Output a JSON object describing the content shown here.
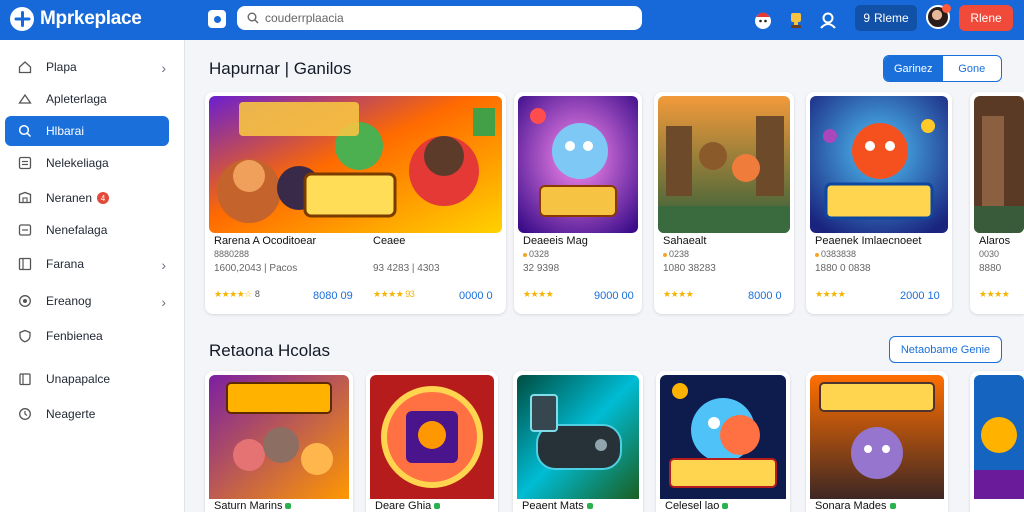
{
  "app": {
    "name": "Mprkeplace"
  },
  "search": {
    "placeholder": "couderrplaacia"
  },
  "header": {
    "pill_dark_label": "Rleme",
    "pill_dark_prefix": "9",
    "pill_red_label": "Rlene"
  },
  "sidebar": {
    "items": [
      {
        "label": "Plapa",
        "icon": "home-icon",
        "chevron": true
      },
      {
        "label": "Apleterlaga",
        "icon": "cloud-icon",
        "chevron": false
      },
      {
        "label": "Hlbarai",
        "icon": "search-icon",
        "chevron": false,
        "active": true
      },
      {
        "label": "Nelekeliaga",
        "icon": "grid-icon",
        "chevron": false
      },
      {
        "label": "Neranen",
        "icon": "chat-icon",
        "chevron": false,
        "badge": "4"
      },
      {
        "label": "Nenefalaga",
        "icon": "doc-icon",
        "chevron": false
      },
      {
        "label": "Farana",
        "icon": "calendar-icon",
        "chevron": true
      },
      {
        "label": "Ereanog",
        "icon": "gear-icon",
        "chevron": true
      },
      {
        "label": "Fenbienea",
        "icon": "shield-icon",
        "chevron": false
      },
      {
        "label": "Unapapalce",
        "icon": "box-icon",
        "chevron": false
      },
      {
        "label": "Neagerte",
        "icon": "clock-icon",
        "chevron": false
      }
    ]
  },
  "section1": {
    "title": "Hapurnar | Ganilos",
    "toggle": {
      "active": "Garinez",
      "inactive": "Gone"
    },
    "cards": [
      {
        "title": "Rarena A Ocoditoear",
        "title2": "Ceaee",
        "sub": "8880288",
        "meta": "1600,2043 | Pacos",
        "meta2": "93 4283 | 4303",
        "stars": "★★★★☆",
        "rating": "8",
        "rating2": "★★★★ 93",
        "price": "8080 09",
        "price2": "0000 0"
      },
      {
        "title": "Deaeeis Mag",
        "sub": "0328",
        "meta": "32 9398",
        "stars": "★★★★",
        "rating": "",
        "price": "9000 00"
      },
      {
        "title": "Sahaealt",
        "sub": "0238",
        "meta": "1080 38283",
        "stars": "★★★★",
        "rating": "",
        "price": "8000 0"
      },
      {
        "title": "Peaenek Imlaecnoeet",
        "sub": "0383838",
        "meta": "1880 0 0838",
        "stars": "★★★★",
        "rating": "",
        "price": "2000 10"
      },
      {
        "title": "Alaros",
        "sub": "0030",
        "meta": "8880",
        "stars": "★★★★",
        "rating": "",
        "price": ""
      }
    ]
  },
  "section2": {
    "title": "Retaona Hcolas",
    "button": "Netaobame Genie",
    "cards": [
      {
        "title": "Saturn Marins"
      },
      {
        "title": "Deare Ghia"
      },
      {
        "title": "Peaent Mats"
      },
      {
        "title": "Celesel lao"
      },
      {
        "title": "Sonara Mades"
      },
      {
        "title": ""
      }
    ]
  },
  "colors": {
    "brand": "#1769d9",
    "accent": "#1a6fdb",
    "danger": "#ef4a3a",
    "star": "#f4b400"
  }
}
